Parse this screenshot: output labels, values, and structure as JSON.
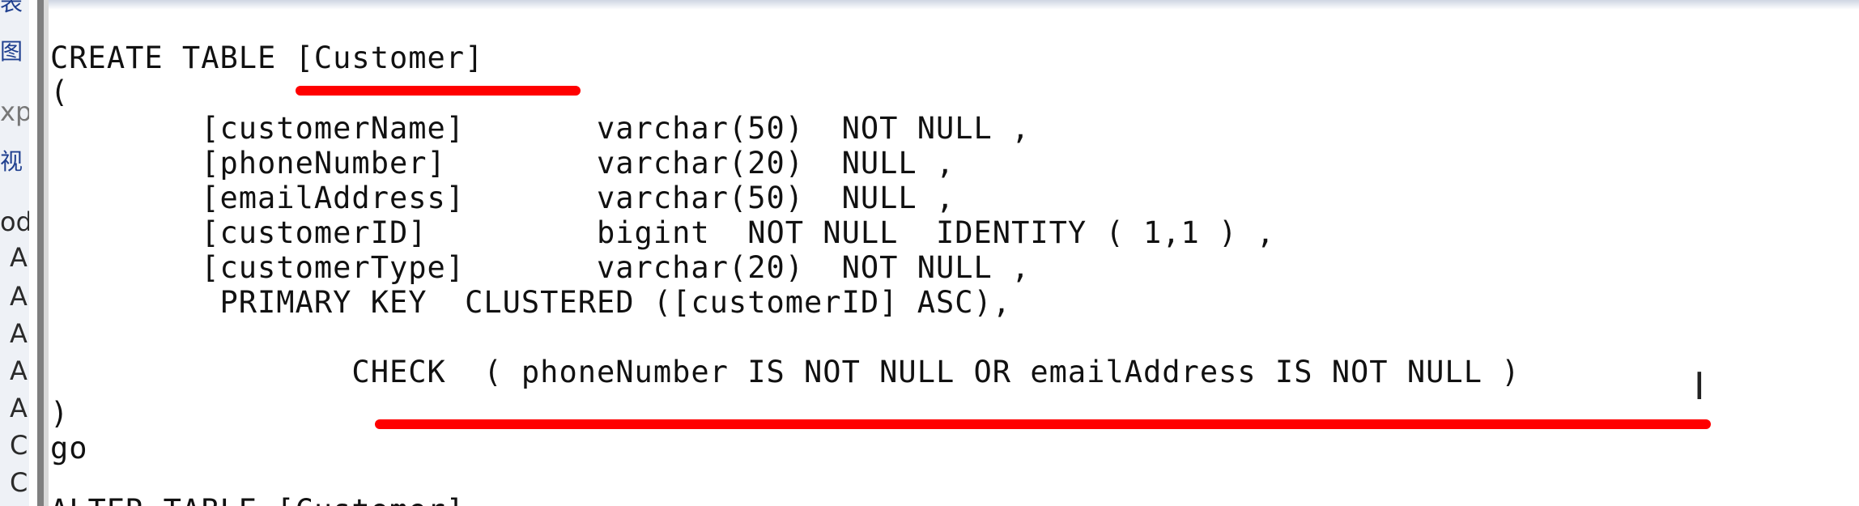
{
  "left_panel": {
    "items": [
      {
        "label": "表",
        "kind": "icon"
      },
      {
        "label": "图",
        "kind": "icon"
      },
      {
        "label": "xp",
        "kind": "text"
      },
      {
        "label": "视",
        "kind": "icon"
      },
      {
        "label": "od",
        "kind": "text"
      },
      {
        "label": "A",
        "kind": "text"
      },
      {
        "label": "A",
        "kind": "text"
      },
      {
        "label": "A",
        "kind": "text"
      },
      {
        "label": "A",
        "kind": "text"
      },
      {
        "label": "A",
        "kind": "text"
      },
      {
        "label": "C",
        "kind": "text"
      },
      {
        "label": "C",
        "kind": "text"
      }
    ]
  },
  "editor": {
    "lines": [
      "CREATE TABLE [Customer]",
      "(",
      "        [customerName]       varchar(50)  NOT NULL ,",
      "        [phoneNumber]        varchar(20)  NULL ,",
      "        [emailAddress]       varchar(50)  NULL ,",
      "        [customerID]         bigint  NOT NULL  IDENTITY ( 1,1 ) ,",
      "        [customerType]       varchar(20)  NOT NULL ,",
      "         PRIMARY KEY  CLUSTERED ([customerID] ASC),",
      "",
      "                CHECK  ( phoneNumber IS NOT NULL OR emailAddress IS NOT NULL )",
      ")",
      "go",
      "",
      "ALTER TABLE [Customer]"
    ],
    "annotation_color": "#ff0000",
    "cursor_glyph": "I"
  }
}
